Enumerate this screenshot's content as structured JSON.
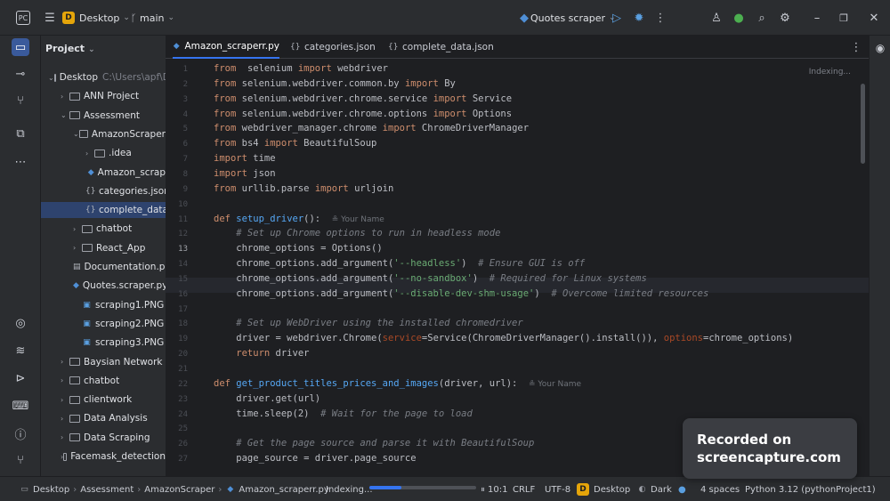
{
  "topbar": {
    "project_badge": "D",
    "project_name": "Desktop",
    "branch": "main",
    "run_config": "Quotes scraper"
  },
  "project_panel": {
    "title": "Project",
    "tree": [
      {
        "label": "Desktop",
        "hint": "C:\\Users\\apf\\D",
        "kind": "folder",
        "open": true,
        "depth": 0
      },
      {
        "label": "ANN Project",
        "kind": "folder",
        "open": false,
        "depth": 1
      },
      {
        "label": "Assessment",
        "kind": "folder",
        "open": true,
        "depth": 1
      },
      {
        "label": "AmazonScraper",
        "kind": "folder",
        "open": true,
        "depth": 2
      },
      {
        "label": ".idea",
        "kind": "folder",
        "open": false,
        "depth": 3
      },
      {
        "label": "Amazon_scrap",
        "kind": "py",
        "depth": 3
      },
      {
        "label": "categories.json",
        "kind": "json",
        "depth": 3
      },
      {
        "label": "complete_data",
        "kind": "json",
        "depth": 3,
        "selected": true
      },
      {
        "label": "chatbot",
        "kind": "folder",
        "open": false,
        "depth": 2
      },
      {
        "label": "React_App",
        "kind": "folder",
        "open": false,
        "depth": 2
      },
      {
        "label": "Documentation.pd",
        "kind": "doc",
        "depth": 2
      },
      {
        "label": "Quotes.scraper.py",
        "kind": "py",
        "depth": 2
      },
      {
        "label": "scraping1.PNG",
        "kind": "img",
        "depth": 2
      },
      {
        "label": "scraping2.PNG",
        "kind": "img",
        "depth": 2
      },
      {
        "label": "scraping3.PNG",
        "kind": "img",
        "depth": 2
      },
      {
        "label": "Baysian Network",
        "kind": "folder",
        "open": false,
        "depth": 1
      },
      {
        "label": "chatbot",
        "kind": "folder",
        "open": false,
        "depth": 1
      },
      {
        "label": "clientwork",
        "kind": "folder",
        "open": false,
        "depth": 1
      },
      {
        "label": "Data Analysis",
        "kind": "folder",
        "open": false,
        "depth": 1
      },
      {
        "label": "Data Scraping",
        "kind": "folder",
        "open": false,
        "depth": 1
      },
      {
        "label": "Facemask_detection",
        "kind": "folder",
        "open": false,
        "depth": 1
      }
    ]
  },
  "tabs": [
    {
      "label": "Amazon_scraperr.py",
      "kind": "py",
      "active": true
    },
    {
      "label": "categories.json",
      "kind": "json",
      "active": false
    },
    {
      "label": "complete_data.json",
      "kind": "json",
      "active": false
    }
  ],
  "editor": {
    "indexing_label": "Indexing...",
    "current_line": "13",
    "author_hint": "Your Name",
    "lines": [
      {
        "n": "1",
        "t": [
          [
            "kw",
            "from"
          ],
          [
            "",
            "  selenium "
          ],
          [
            "kw",
            "import"
          ],
          [
            "",
            " webdriver"
          ]
        ]
      },
      {
        "n": "2",
        "t": [
          [
            "kw",
            "from"
          ],
          [
            "",
            " selenium.webdriver.common.by "
          ],
          [
            "kw",
            "import"
          ],
          [
            "",
            " By"
          ]
        ]
      },
      {
        "n": "3",
        "t": [
          [
            "kw",
            "from"
          ],
          [
            "",
            " selenium.webdriver.chrome.service "
          ],
          [
            "kw",
            "import"
          ],
          [
            "",
            " Service"
          ]
        ]
      },
      {
        "n": "4",
        "t": [
          [
            "kw",
            "from"
          ],
          [
            "",
            " selenium.webdriver.chrome.options "
          ],
          [
            "kw",
            "import"
          ],
          [
            "",
            " Options"
          ]
        ]
      },
      {
        "n": "5",
        "t": [
          [
            "kw",
            "from"
          ],
          [
            "",
            " webdriver_manager.chrome "
          ],
          [
            "kw",
            "import"
          ],
          [
            "",
            " ChromeDriverManager"
          ]
        ]
      },
      {
        "n": "6",
        "t": [
          [
            "kw",
            "from"
          ],
          [
            "",
            " bs4 "
          ],
          [
            "kw",
            "import"
          ],
          [
            "",
            " BeautifulSoup"
          ]
        ]
      },
      {
        "n": "7",
        "t": [
          [
            "kw",
            "import"
          ],
          [
            "",
            " time"
          ]
        ]
      },
      {
        "n": "8",
        "t": [
          [
            "kw",
            "import"
          ],
          [
            "",
            " json"
          ]
        ]
      },
      {
        "n": "9",
        "t": [
          [
            "kw",
            "from"
          ],
          [
            "",
            " urllib.parse "
          ],
          [
            "kw",
            "import"
          ],
          [
            "",
            " urljoin"
          ]
        ]
      },
      {
        "n": "10",
        "t": []
      },
      {
        "n": "11",
        "t": [
          [
            "kw",
            "def"
          ],
          [
            "",
            " "
          ],
          [
            "fn",
            "setup_driver"
          ],
          [
            "",
            "():  "
          ],
          [
            "hint",
            "≗ Your Name"
          ]
        ]
      },
      {
        "n": "12",
        "t": [
          [
            "cm",
            "    # Set up Chrome options to run in headless mode"
          ]
        ]
      },
      {
        "n": "13",
        "t": [
          [
            "",
            "    chrome_options = Options()"
          ]
        ]
      },
      {
        "n": "14",
        "t": [
          [
            "",
            "    chrome_options.add_argument("
          ],
          [
            "str",
            "'--headless'"
          ],
          [
            "",
            ")  "
          ],
          [
            "cm",
            "# Ensure GUI is off"
          ]
        ]
      },
      {
        "n": "15",
        "t": [
          [
            "",
            "    chrome_options.add_argument("
          ],
          [
            "str",
            "'--no-sandbox'"
          ],
          [
            "",
            ")  "
          ],
          [
            "cm",
            "# Required for Linux systems"
          ]
        ]
      },
      {
        "n": "16",
        "t": [
          [
            "",
            "    chrome_options.add_argument("
          ],
          [
            "str",
            "'--disable-dev-shm-usage'"
          ],
          [
            "",
            ")  "
          ],
          [
            "cm",
            "# Overcome limited resources"
          ]
        ]
      },
      {
        "n": "17",
        "t": []
      },
      {
        "n": "18",
        "t": [
          [
            "cm",
            "    # Set up WebDriver using the installed chromedriver"
          ]
        ]
      },
      {
        "n": "19",
        "t": [
          [
            "",
            "    driver = webdriver.Chrome("
          ],
          [
            "pr",
            "service"
          ],
          [
            "",
            "=Service(ChromeDriverManager().install()), "
          ],
          [
            "pr",
            "options"
          ],
          [
            "",
            "=chrome_options)"
          ]
        ]
      },
      {
        "n": "20",
        "t": [
          [
            "kw",
            "    return"
          ],
          [
            "",
            " driver"
          ]
        ]
      },
      {
        "n": "21",
        "t": []
      },
      {
        "n": "22",
        "t": [
          [
            "kw",
            "def"
          ],
          [
            "",
            " "
          ],
          [
            "fn",
            "get_product_titles_prices_and_images"
          ],
          [
            "",
            "(driver, url):  "
          ],
          [
            "hint",
            "≗ Your Name"
          ]
        ]
      },
      {
        "n": "23",
        "t": [
          [
            "",
            "    driver.get(url)"
          ]
        ]
      },
      {
        "n": "24",
        "t": [
          [
            "",
            "    time.sleep("
          ],
          [
            "",
            "2"
          ],
          [
            "",
            ")  "
          ],
          [
            "cm",
            "# Wait for the page to load"
          ]
        ]
      },
      {
        "n": "25",
        "t": []
      },
      {
        "n": "26",
        "t": [
          [
            "cm",
            "    # Get the page source and parse it with BeautifulSoup"
          ]
        ]
      },
      {
        "n": "27",
        "t": [
          [
            "",
            "    page_source = driver.page_source"
          ]
        ]
      }
    ]
  },
  "statusbar": {
    "breadcrumbs": [
      "Desktop",
      "Assessment",
      "AmazonScraper",
      "Amazon_scraperr.py"
    ],
    "indexing": "Indexing...",
    "progress": 0.3,
    "position": "10:1",
    "line_sep": "CRLF",
    "encoding": "UTF-8",
    "project_badge": "D",
    "project_name": "Desktop",
    "theme": "Dark",
    "indent": "4 spaces",
    "interpreter": "Python 3.12 (pythonProject1)"
  },
  "watermark": {
    "line1": "Recorded on",
    "line2": "screencapture.com"
  }
}
